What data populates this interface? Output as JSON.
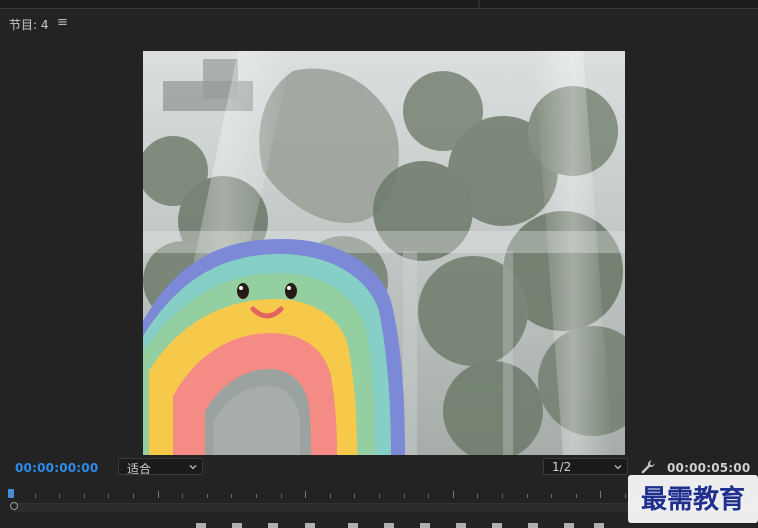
{
  "panel": {
    "title": "节目: 4",
    "menu_glyph": "≡"
  },
  "viewer": {
    "content": "video-frame"
  },
  "controls": {
    "current_timecode": "00:00:00:00",
    "zoom_value": "适合",
    "resolution_value": "1/2",
    "duration_timecode": "00:00:05:00"
  },
  "icons": {
    "menu": "hamburger-menu-icon",
    "chevron": "chevron-down-icon",
    "settings": "wrench-icon",
    "playhead": "playhead-marker-icon"
  },
  "colors": {
    "timecode_current": "#2d8ceb",
    "panel_bg": "#232323",
    "watermark": "#1e2f8f"
  },
  "watermark": {
    "text": "最需教育"
  }
}
